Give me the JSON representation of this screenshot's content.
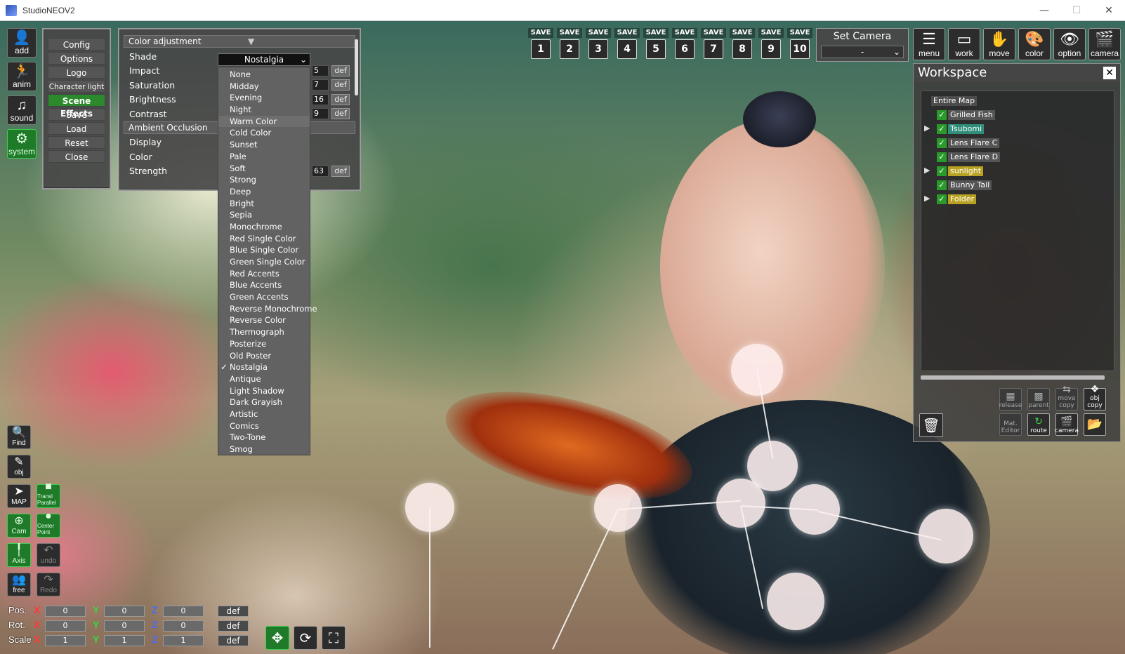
{
  "window": {
    "title": "StudioNEOV2"
  },
  "left_tools": {
    "add": "add",
    "anim": "anim",
    "sound": "sound",
    "system": "system",
    "find": "Find",
    "obj": "obj",
    "map": "MAP",
    "transl": "Transl Parallel",
    "cam": "Cam",
    "center": "Center Point",
    "axis": "Axis",
    "undo": "undo",
    "free": "free",
    "redo": "Redo"
  },
  "menu": {
    "items": [
      "Config",
      "Options",
      "Logo",
      "Character light",
      "Scene Effects",
      "Save",
      "Load",
      "Reset",
      "Close"
    ],
    "active": "Scene Effects"
  },
  "color_adjustment": {
    "header": "Color adjustment",
    "rows": [
      {
        "label": "Shade",
        "value": "Nostalgia"
      },
      {
        "label": "Impact",
        "value": "5",
        "def": "def"
      },
      {
        "label": "Saturation",
        "value": "7",
        "def": "def"
      },
      {
        "label": "Brightness",
        "value": "16",
        "def": "def"
      },
      {
        "label": "Contrast",
        "value": "9",
        "def": "def"
      }
    ],
    "ambient_header": "Ambient Occlusion",
    "ambient_rows": [
      {
        "label": "Display"
      },
      {
        "label": "Color"
      },
      {
        "label": "Strength",
        "value": "63",
        "def": "def"
      }
    ]
  },
  "shade_dropdown": {
    "options": [
      "None",
      "Midday",
      "Evening",
      "Night",
      "Warm Color",
      "Cold Color",
      "Sunset",
      "Pale",
      "Soft",
      "Strong",
      "Deep",
      "Bright",
      "Sepia",
      "Monochrome",
      "Red Single Color",
      "Blue Single Color",
      "Green Single Color",
      "Red Accents",
      "Blue Accents",
      "Green Accents",
      "Reverse Monochrome",
      "Reverse Color",
      "Thermograph",
      "Posterize",
      "Old Poster",
      "Nostalgia",
      "Antique",
      "Light Shadow",
      "Dark Grayish",
      "Artistic",
      "Comics",
      "Two-Tone",
      "Smog"
    ],
    "selected": "Nostalgia",
    "hovered": "Warm Color"
  },
  "save_slots": {
    "label": "SAVE",
    "numbers": [
      "1",
      "2",
      "3",
      "4",
      "5",
      "6",
      "7",
      "8",
      "9",
      "10"
    ]
  },
  "set_camera": {
    "title": "Set Camera",
    "value": "-"
  },
  "top_icons": [
    "menu",
    "work",
    "move",
    "color",
    "option",
    "camera"
  ],
  "workspace": {
    "title": "Workspace",
    "close": "✕",
    "root": "Entire Map",
    "items": [
      {
        "name": "Grilled Fish",
        "arrow": "",
        "highlight": ""
      },
      {
        "name": "Tsubomi",
        "arrow": "▶",
        "highlight": "teal"
      },
      {
        "name": "Lens Flare C",
        "arrow": "",
        "highlight": ""
      },
      {
        "name": "Lens Flare D",
        "arrow": "",
        "highlight": ""
      },
      {
        "name": "sunlight",
        "arrow": "▶",
        "highlight": "yellow"
      },
      {
        "name": "Bunny Tail",
        "arrow": "",
        "highlight": ""
      },
      {
        "name": "Folder",
        "arrow": "▶",
        "highlight": "yellow"
      }
    ],
    "buttons": {
      "release": "release",
      "parent": "parent",
      "move_copy": "move copy",
      "obj_copy": "obj copy",
      "mat_editor": "Mat. Editor",
      "route": "route",
      "camera": "camera"
    }
  },
  "transform": {
    "pos_label": "Pos.",
    "rot_label": "Rot.",
    "scale_label": "Scale",
    "axis_x": "X",
    "axis_y": "Y",
    "axis_z": "Z",
    "pos": [
      "0",
      "0",
      "0"
    ],
    "rot": [
      "0",
      "0",
      "0"
    ],
    "scale": [
      "1",
      "1",
      "1"
    ],
    "def": "def"
  },
  "colors": {
    "accent_green": "#2b8a2b",
    "axis_x": "#ff3a3a",
    "axis_y": "#3ad83a",
    "axis_z": "#4a6aff",
    "highlight_teal": "#2f8f7a",
    "highlight_yellow": "#b8a020"
  }
}
